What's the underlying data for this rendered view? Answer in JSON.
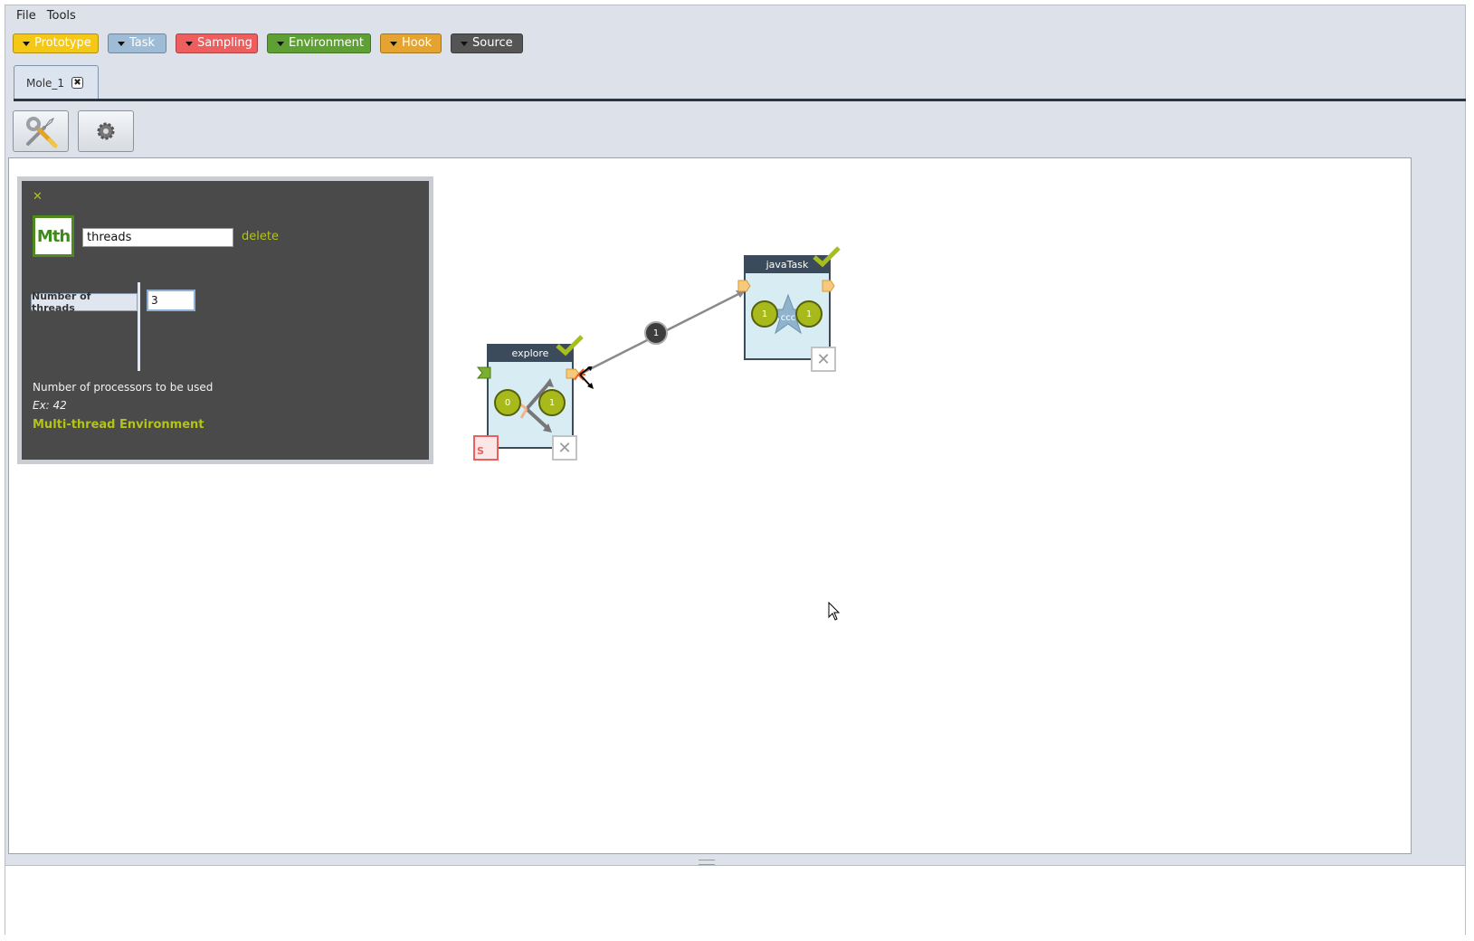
{
  "menu": [
    "File",
    "Tools"
  ],
  "palette": [
    {
      "label": "Prototype",
      "bg": "#f5c816",
      "fg": "#ffffff"
    },
    {
      "label": "Task",
      "bg": "#9fbcd6",
      "fg": "#ffffff"
    },
    {
      "label": "Sampling",
      "bg": "#ef5e5e",
      "fg": "#ffffff"
    },
    {
      "label": "Environment",
      "bg": "#5fa035",
      "fg": "#ffffff"
    },
    {
      "label": "Hook",
      "bg": "#e4a42f",
      "fg": "#ffffff"
    },
    {
      "label": "Source",
      "bg": "#555555",
      "fg": "#ffffff"
    }
  ],
  "tabs": [
    {
      "label": "Mole_1",
      "close_glyph": "✖"
    }
  ],
  "toolbar": {
    "build_icon": "wrench-screwdriver-icon",
    "run_icon": "gear-icon"
  },
  "panel": {
    "close_glyph": "✕",
    "icon_text": "Mth",
    "name_value": "threads",
    "delete_label": "delete",
    "param_label": "Number of threads",
    "param_value": "3",
    "description": "Number of processors to be used",
    "example": "Ex: 42",
    "environment_name": "Multi-thread Environment",
    "accent": "#b3c317"
  },
  "capsules": [
    {
      "title": "explore",
      "inputs": "0",
      "outputs": "1"
    },
    {
      "title": "javaTask",
      "inputs": "1",
      "outputs": "1"
    }
  ],
  "transition": {
    "label": "1"
  },
  "xbox_glyph": "✕",
  "sampling_badge": "S"
}
